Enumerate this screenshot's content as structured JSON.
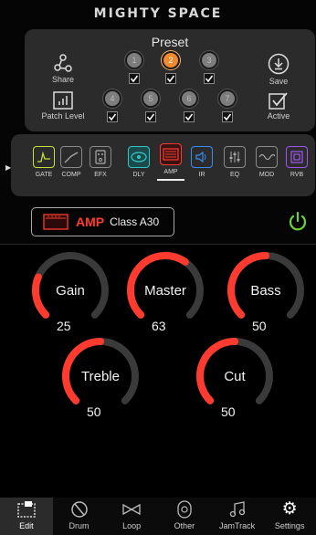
{
  "header": {
    "title": "MIGHTY SPACE"
  },
  "preset": {
    "title": "Preset",
    "slots": [
      {
        "number": "1",
        "checked": true
      },
      {
        "number": "2",
        "checked": true,
        "active": true
      },
      {
        "number": "3",
        "checked": true
      },
      {
        "number": "4",
        "checked": true
      },
      {
        "number": "5",
        "checked": true
      },
      {
        "number": "6",
        "checked": true
      },
      {
        "number": "7",
        "checked": true
      }
    ],
    "share_label": "Share",
    "patch_level_label": "Patch Level",
    "save_label": "Save",
    "active_label": "Active"
  },
  "fx_chain": [
    {
      "name": "GATE",
      "color": "#c6e03a"
    },
    {
      "name": "COMP",
      "color": "#8a8a8a"
    },
    {
      "name": "EFX",
      "color": "#8a8a8a"
    },
    {
      "name": "DLY",
      "color": "#2fc6c8"
    },
    {
      "name": "AMP",
      "color": "#ff3b2f",
      "selected": true
    },
    {
      "name": "IR",
      "color": "#3a8bf0"
    },
    {
      "name": "EQ",
      "color": "#8a8a8a"
    },
    {
      "name": "MOD",
      "color": "#8a8a8a"
    },
    {
      "name": "RVB",
      "color": "#a055f0"
    }
  ],
  "amp": {
    "label": "AMP",
    "model": "Class A30"
  },
  "knobs": [
    {
      "label": "Gain",
      "value": "25",
      "level": 0.25
    },
    {
      "label": "Master",
      "value": "63",
      "level": 0.63
    },
    {
      "label": "Bass",
      "value": "50",
      "level": 0.5
    },
    {
      "label": "Treble",
      "value": "50",
      "level": 0.5
    },
    {
      "label": "Cut",
      "value": "50",
      "level": 0.5
    }
  ],
  "tabs": [
    {
      "label": "Edit",
      "active": true
    },
    {
      "label": "Drum"
    },
    {
      "label": "Loop"
    },
    {
      "label": "Other"
    },
    {
      "label": "JamTrack"
    },
    {
      "label": "Settings"
    }
  ],
  "colors": {
    "accent_red": "#ff3b2f",
    "active_orange": "#f08a2c",
    "power_green": "#6fd13a",
    "panel": "#2b2b2b"
  }
}
